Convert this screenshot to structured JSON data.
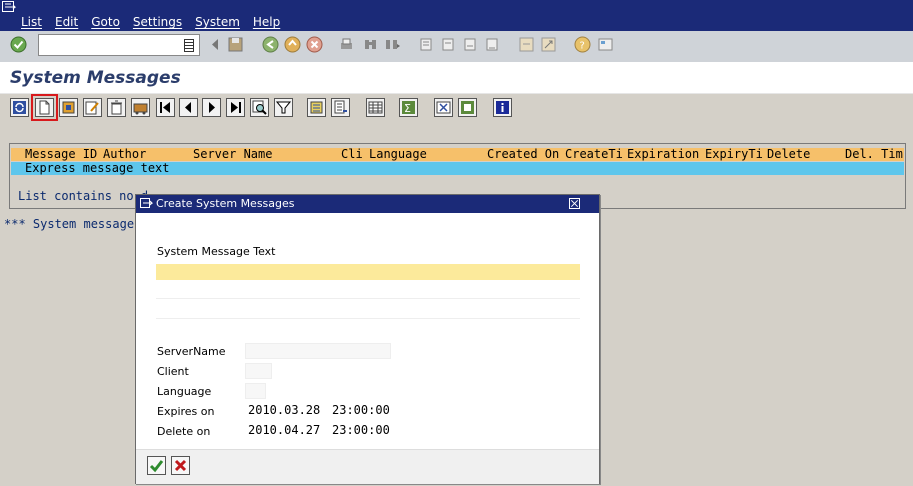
{
  "menu": {
    "items": [
      "List",
      "Edit",
      "Goto",
      "Settings",
      "System",
      "Help"
    ]
  },
  "command_field": {
    "value": ""
  },
  "page": {
    "title": "System Messages"
  },
  "list": {
    "header": {
      "message_id": "Message ID",
      "author": "Author",
      "server_name": "Server Name",
      "client": "Cli",
      "language": "Language",
      "created_on": "Created On",
      "create_time": "CreateTi",
      "expiration": "Expiration",
      "expiry_time": "ExpiryTi",
      "delete": "Delete",
      "del_time": "Del. Tim"
    },
    "row_text": "Express message text",
    "empty_note": "List contains no d",
    "status_note": "*** System message"
  },
  "dialog": {
    "title": "Create System Messages",
    "message_text_label": "System Message Text",
    "server_name_label": "ServerName",
    "client_label": "Client",
    "language_label": "Language",
    "expires_label": "Expires on",
    "expires_date": "2010.03.28",
    "expires_time": "23:00:00",
    "delete_label": "Delete on",
    "delete_date": "2010.04.27",
    "delete_time": "23:00:00"
  },
  "colors": {
    "menubar": "#1b2a78",
    "list_header": "#f6c06a",
    "selected_row": "#5ec6ec",
    "required_field": "#fcea9b",
    "highlight": "#d8191c"
  }
}
